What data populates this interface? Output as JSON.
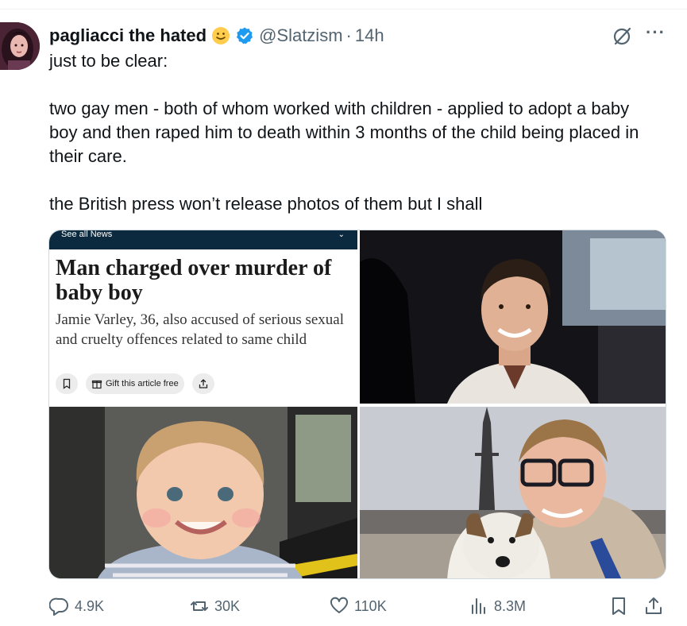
{
  "tweet": {
    "author_name": "pagliacci the hated",
    "name_emoji": "slightly-smiling-face",
    "verified_color": "#1d9bf0",
    "handle": "@Slatzism",
    "separator": "·",
    "time": "14h",
    "more_label": "···",
    "paragraphs": [
      "just to be clear:",
      "two gay men - both of whom worked with children - applied to adopt a baby boy and then raped him to death within 3 months of the child being placed in their care.",
      "the British press won’t release photos of them but I shall"
    ]
  },
  "media": {
    "news_card": {
      "top_bar": "See all News",
      "headline": "Man charged over murder of baby boy",
      "standfirst": "Jamie Varley, 36, also accused of serious sexual and cruelty offences related to same child",
      "gift_label": "Gift this article free"
    }
  },
  "actions": {
    "replies": "4.9K",
    "reposts": "30K",
    "likes": "110K",
    "views": "8.3M"
  },
  "colors": {
    "text": "#0f1419",
    "muted": "#536471",
    "border": "#cfd9de",
    "news_bar": "#0b2a3f"
  }
}
